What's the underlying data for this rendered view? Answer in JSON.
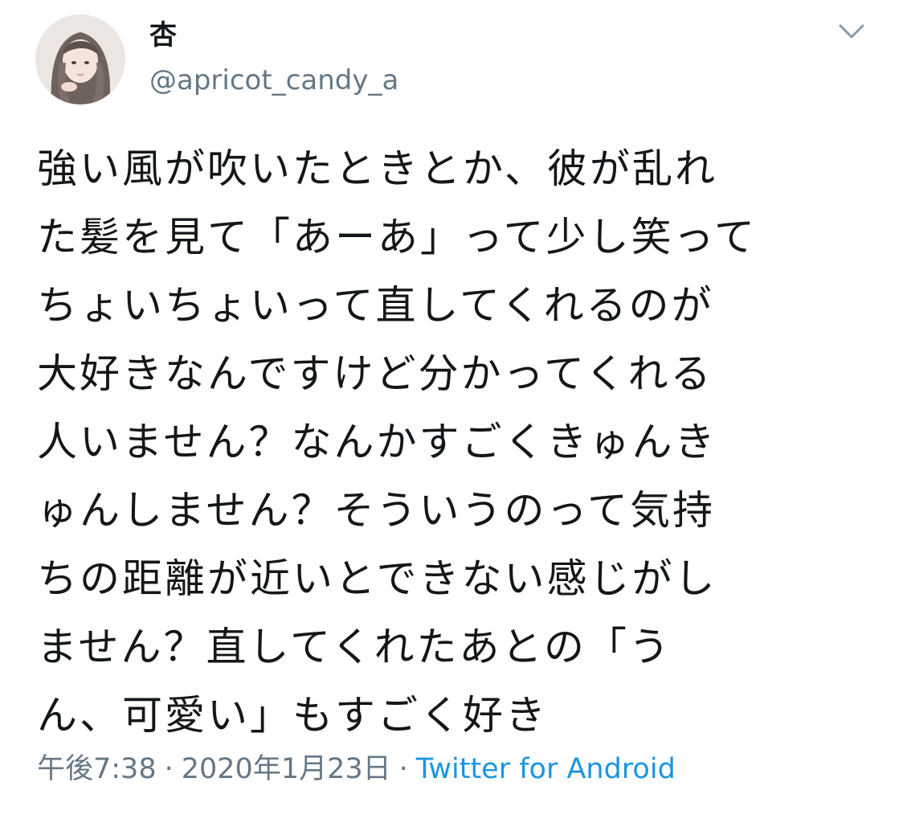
{
  "user": {
    "display_name": "杏",
    "handle": "@apricot_candy_a",
    "avatar_icon": "avatar-illustration"
  },
  "menu": {
    "icon": "chevron-down-icon"
  },
  "tweet": {
    "lines": [
      "強い風が吹いたときとか、彼が乱れ",
      "た髪を見て「あーあ」って少し笑って",
      "ちょいちょいって直してくれるのが",
      "大好きなんですけど分かってくれる",
      "人いません？なんかすごくきゅんき",
      "ゅんしません？そういうのって気持",
      "ちの距離が近いとできない感じがし",
      "ません？直してくれたあとの「う",
      "ん、可愛い」もすごく好き"
    ]
  },
  "meta": {
    "time": "午後7:38",
    "separator": "·",
    "date": "2020年1月23日",
    "source": "Twitter for Android"
  },
  "colors": {
    "text": "#14171a",
    "muted": "#657786",
    "link": "#1b95e0"
  }
}
